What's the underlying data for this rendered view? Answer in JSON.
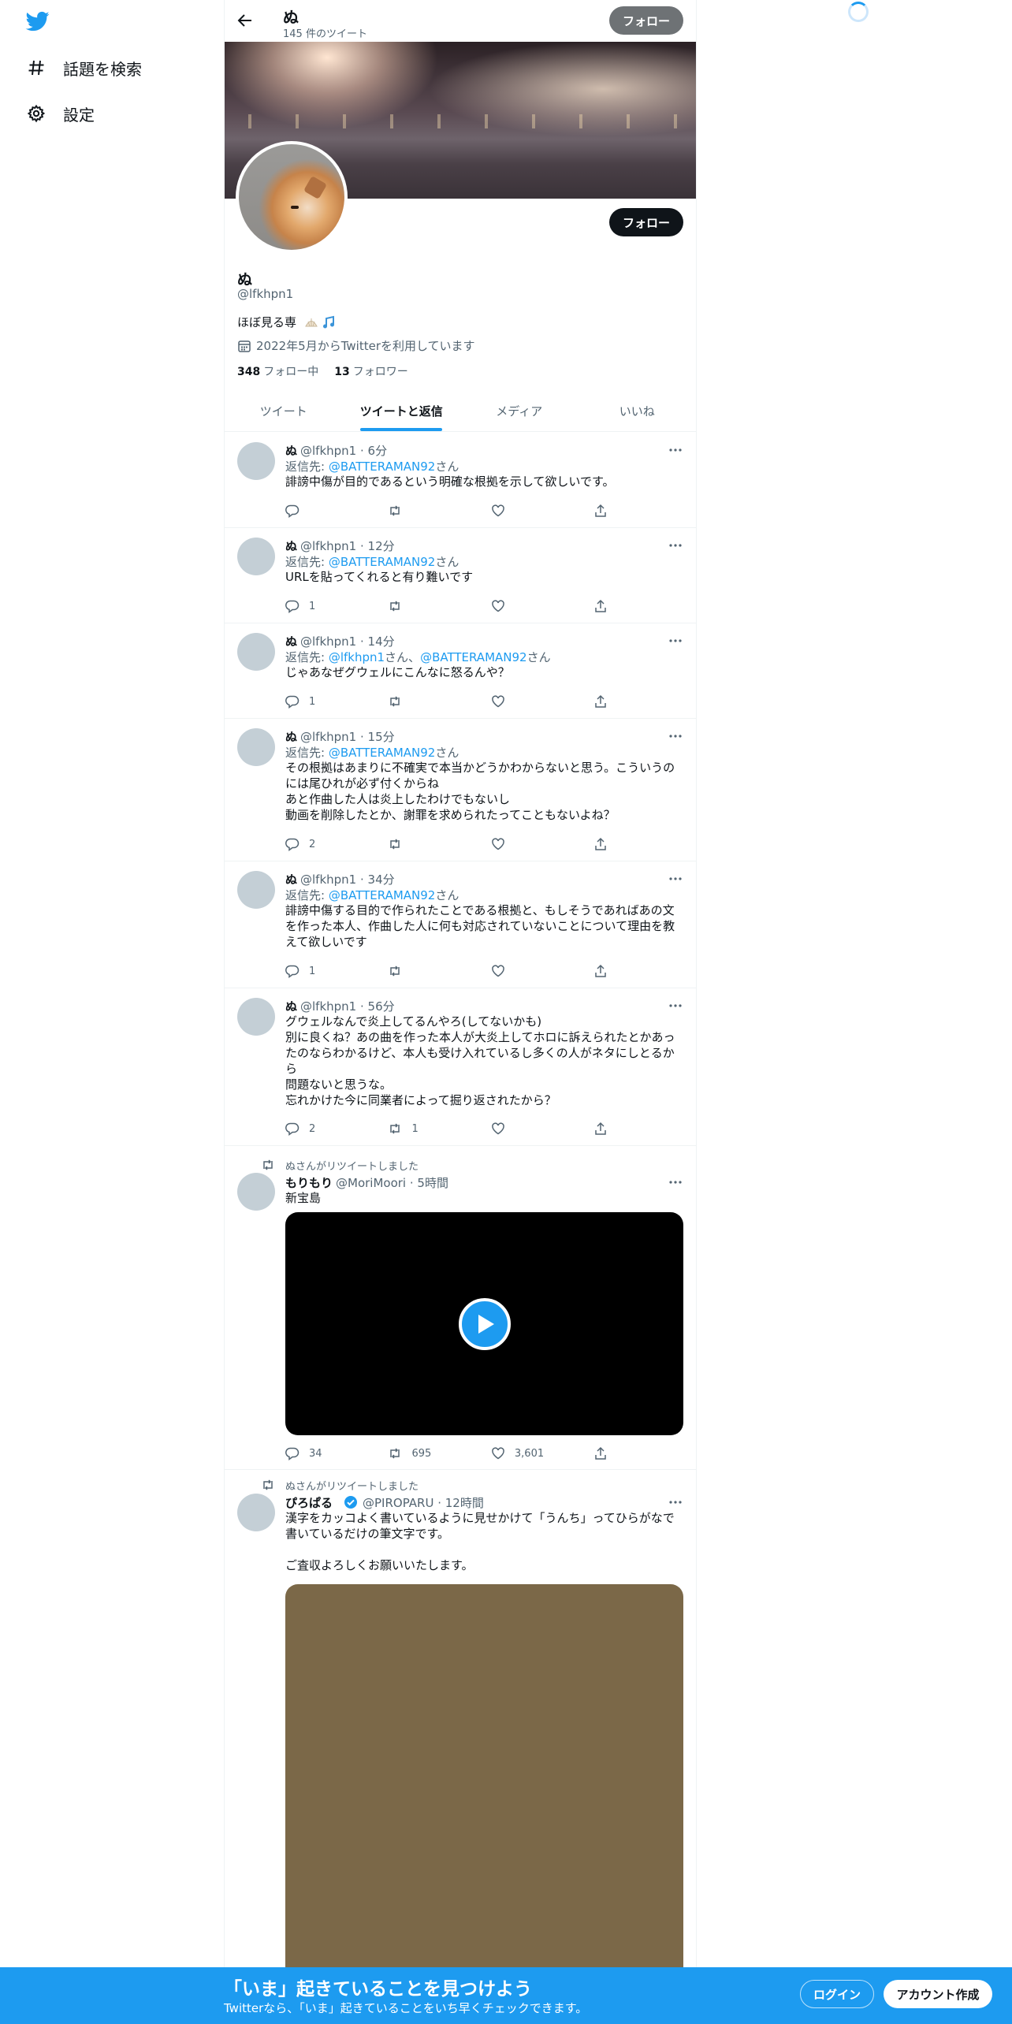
{
  "nav": {
    "explore_label": "話題を検索",
    "settings_label": "設定"
  },
  "header": {
    "name": "ぬ",
    "tweet_count": "145 件のツイート",
    "follow_label": "フォロー"
  },
  "profile": {
    "follow_label": "フォロー",
    "name": "ぬ",
    "handle": "@lfkhpn1",
    "bio": "ほぼ見る専",
    "joined": "2022年5月からTwitterを利用しています",
    "following_count": "348",
    "following_label": "フォロー中",
    "followers_count": "13",
    "followers_label": "フォロワー"
  },
  "tabs": [
    {
      "label": "ツイート"
    },
    {
      "label": "ツイートと返信"
    },
    {
      "label": "メディア"
    },
    {
      "label": "いいね"
    }
  ],
  "tweets": [
    {
      "name": "ぬ",
      "meta": "@lfkhpn1 · 6分",
      "reply_prefix": "返信先: ",
      "reply_to": "@BATTERAMAN92",
      "reply_suffix": "さん",
      "text": "誹謗中傷が目的であるという明確な根拠を示して欲しいです。",
      "replies": "",
      "retweets": "",
      "likes": ""
    },
    {
      "name": "ぬ",
      "meta": "@lfkhpn1 · 12分",
      "reply_prefix": "返信先: ",
      "reply_to": "@BATTERAMAN92",
      "reply_suffix": "さん",
      "text": "URLを貼ってくれると有り難いです",
      "replies": "1",
      "retweets": "",
      "likes": ""
    },
    {
      "name": "ぬ",
      "meta": "@lfkhpn1 · 14分",
      "reply_prefix": "返信先: ",
      "reply_to": "@lfkhpn1",
      "reply_mid": "さん、",
      "reply_to2": "@BATTERAMAN92",
      "reply_suffix": "さん",
      "text": "じゃあなぜグウェルにこんなに怒るんや？",
      "replies": "1",
      "retweets": "",
      "likes": ""
    },
    {
      "name": "ぬ",
      "meta": "@lfkhpn1 · 15分",
      "reply_prefix": "返信先: ",
      "reply_to": "@BATTERAMAN92",
      "reply_suffix": "さん",
      "text": "その根拠はあまりに不確実で本当かどうかわからないと思う。こういうのには尾ひれが必ず付くからね\nあと作曲した人は炎上したわけでもないし\n動画を削除したとか、謝罪を求められたってこともないよね？",
      "replies": "2",
      "retweets": "",
      "likes": ""
    },
    {
      "name": "ぬ",
      "meta": "@lfkhpn1 · 34分",
      "reply_prefix": "返信先: ",
      "reply_to": "@BATTERAMAN92",
      "reply_suffix": "さん",
      "text": "誹謗中傷する目的で作られたことである根拠と、もしそうであればあの文を作った本人、作曲した人に何も対応されていないことについて理由を教えて欲しいです",
      "replies": "1",
      "retweets": "",
      "likes": ""
    },
    {
      "name": "ぬ",
      "meta": "@lfkhpn1 · 56分",
      "text": "グウェルなんで炎上してるんやろ(してないかも)\n別に良くね？あの曲を作った本人が大炎上してホロに訴えられたとかあったのならわかるけど、本人も受け入れているし多くの人がネタにしとるから\n問題ないと思うな。\n忘れかけた今に同業者によって掘り返されたから？",
      "replies": "2",
      "retweets": "1",
      "likes": ""
    },
    {
      "retweet_label": "ぬさんがリツイートしました",
      "name": "もりもり",
      "meta": "@MoriMoori · 5時間",
      "text": "新宝島",
      "replies": "34",
      "retweets": "695",
      "likes": "3,601"
    },
    {
      "retweet_label": "ぬさんがリツイートしました",
      "name": "ぴろぱる",
      "meta": "@PIROPARU · 12時間",
      "text": "漢字をカッコよく書いているように見せかけて「うんち」ってひらがなで書いているだけの筆文字です。\n\nご査収よろしくお願いいたします。"
    }
  ],
  "bottom": {
    "title": "「いま」起きていることを見つけよう",
    "subtitle": "Twitterなら、「いま」起きていることをいち早くチェックできます。",
    "login_label": "ログイン",
    "signup_label": "アカウント作成"
  },
  "icons": {
    "logo": "twitter-bird-icon",
    "explore": "hashtag-icon",
    "settings": "gear-icon",
    "back": "arrow-left-icon"
  },
  "colors": {
    "accent": "#1d9bf0",
    "text": "#0f1419",
    "muted": "#536471"
  }
}
